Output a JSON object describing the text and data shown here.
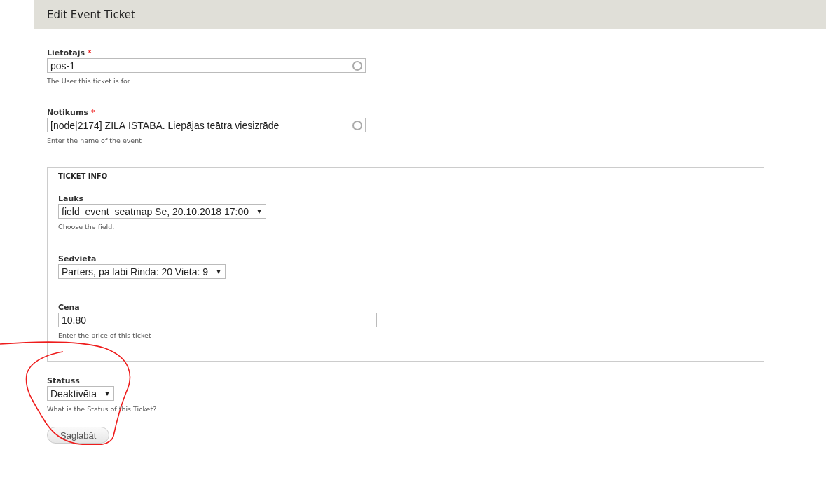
{
  "page_title": "Edit Event Ticket",
  "fields": [
    {
      "kind": "autocomplete",
      "label": "Lietotājs",
      "required_mark": "*",
      "value": "pos-1",
      "description": "The User this ticket is for"
    },
    {
      "kind": "autocomplete",
      "label": "Notikums",
      "required_mark": "*",
      "value": "[node|2174] ZILĀ ISTABA. Liepājas teātra viesizrāde",
      "description": "Enter the name of the event"
    }
  ],
  "fieldset": {
    "legend": "TICKET INFO",
    "fields": [
      {
        "kind": "select",
        "label": "Lauks",
        "value": "field_event_seatmap Se, 20.10.2018 17:00",
        "description": "Choose the field."
      },
      {
        "kind": "select",
        "label": "Sēdvieta",
        "value": "Parters, pa labi Rinda: 20 Vieta: 9"
      },
      {
        "kind": "text",
        "label": "Cena",
        "value": "10.80",
        "description": "Enter the price of this ticket"
      }
    ]
  },
  "after_fields": [
    {
      "kind": "select",
      "label": "Statuss",
      "value": "Deaktivēta",
      "description": "What is the Status of this Ticket?"
    }
  ],
  "submit_button": "Saglabāt"
}
